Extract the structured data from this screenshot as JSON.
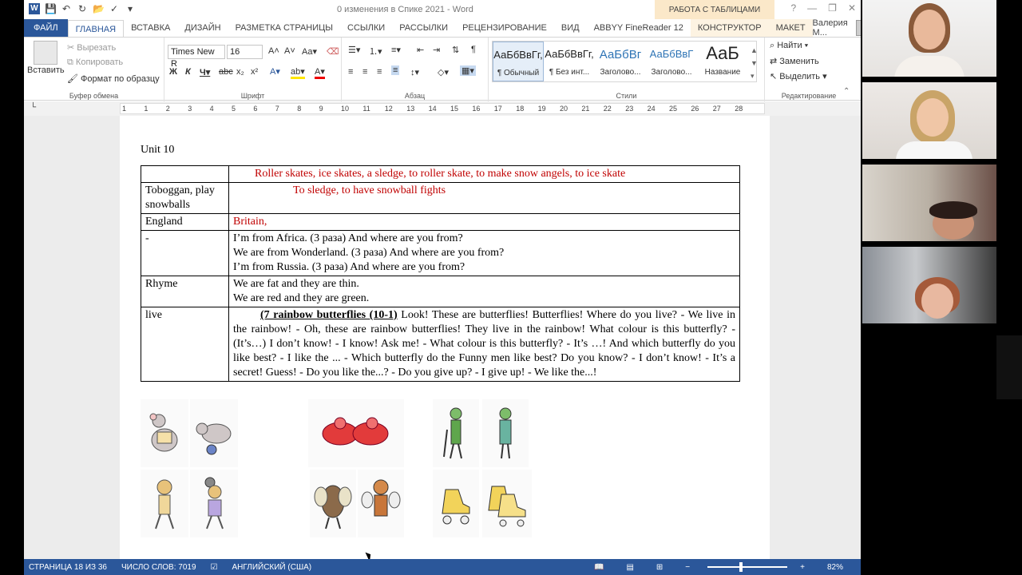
{
  "window": {
    "doc_title": "0 изменения в Спике 2021 - Word",
    "context_title": "РАБОТА С ТАБЛИЦАМИ",
    "help": "?",
    "minimize": "—",
    "restore": "❐",
    "close": "✕"
  },
  "tabs": {
    "file": "ФАЙЛ",
    "home": "ГЛАВНАЯ",
    "insert": "ВСТАВКА",
    "design": "ДИЗАЙН",
    "layout": "РАЗМЕТКА СТРАНИЦЫ",
    "references": "ССЫЛКИ",
    "mailings": "РАССЫЛКИ",
    "review": "РЕЦЕНЗИРОВАНИЕ",
    "view": "ВИД",
    "abbyy": "ABBYY FineReader 12",
    "constructor": "КОНСТРУКТОР",
    "maket": "МАКЕТ",
    "user": "Валерия М..."
  },
  "ribbon": {
    "clipboard": {
      "paste": "Вставить",
      "cut": "Вырезать",
      "copy": "Копировать",
      "format_painter": "Формат по образцу",
      "label": "Буфер обмена"
    },
    "font": {
      "name": "Times New R",
      "size": "16",
      "label": "Шрифт"
    },
    "paragraph": {
      "label": "Абзац"
    },
    "styles": {
      "items": [
        {
          "preview": "АаБбВвГг,",
          "name": "¶ Обычный"
        },
        {
          "preview": "АаБбВвГг,",
          "name": "¶ Без инт..."
        },
        {
          "preview": "АаБбВг",
          "name": "Заголово..."
        },
        {
          "preview": "АаБбВвГ",
          "name": "Заголово..."
        },
        {
          "preview": "АаБ",
          "name": "Название"
        }
      ],
      "label": "Стили"
    },
    "editing": {
      "find": "Найти",
      "replace": "Заменить",
      "select": "Выделить",
      "label": "Редактирование"
    }
  },
  "ruler": {
    "numbers": [
      "1",
      "1",
      "2",
      "3",
      "4",
      "5",
      "6",
      "7",
      "8",
      "9",
      "10",
      "11",
      "12",
      "13",
      "14",
      "15",
      "16",
      "17",
      "18",
      "19",
      "20",
      "21",
      "22",
      "23",
      "24",
      "25",
      "26",
      "27",
      "28"
    ]
  },
  "document": {
    "unit_title": "Unit 10",
    "rows": [
      {
        "c1": "",
        "c2": "Roller skates, ice skates, a sledge, to roller skate, to make snow angels, to ice skate"
      },
      {
        "c1": "Toboggan, play snowballs",
        "c2": "To sledge, to have snowball fights"
      },
      {
        "c1": "England",
        "c2": "Britain,"
      },
      {
        "c1": "-",
        "c2a": "I’m from Africa. (3 раза) And where are you from?",
        "c2b": "We are from Wonderland. (3 раза) And where are you from?",
        "c2c": "I’m from Russia. (3 раза) And where are you from?"
      },
      {
        "c1": "Rhyme",
        "c2a": "We are fat and they are thin.",
        "c2b": "We are red and they are green."
      },
      {
        "c1": "live",
        "bold": "(7 rainbow butterflies (10-1)",
        "text": " Look! These are butterflies!  Butterflies! Where do you live? - We live in the rainbow! - Oh, these are rainbow butterflies! They live in the rainbow! What colour is this butterfly? - (It’s…) I don’t know! - I know! Ask me! - What colour is this butterfly? - It’s …! And which butterfly do you like best? - I like the ... - Which butterfly do the Funny men like best? Do you know? - I don’t know! - It’s a secret! Guess! - Do you like the...? - Do you give up? - I give up! - We like the...!"
      }
    ]
  },
  "status": {
    "page": "СТРАНИЦА 18 ИЗ 36",
    "words": "ЧИСЛО СЛОВ: 7019",
    "language": "АНГЛИЙСКИЙ (США)",
    "zoom": "82%"
  },
  "colors": {
    "accent": "#2b579a",
    "red_text": "#c00000"
  }
}
